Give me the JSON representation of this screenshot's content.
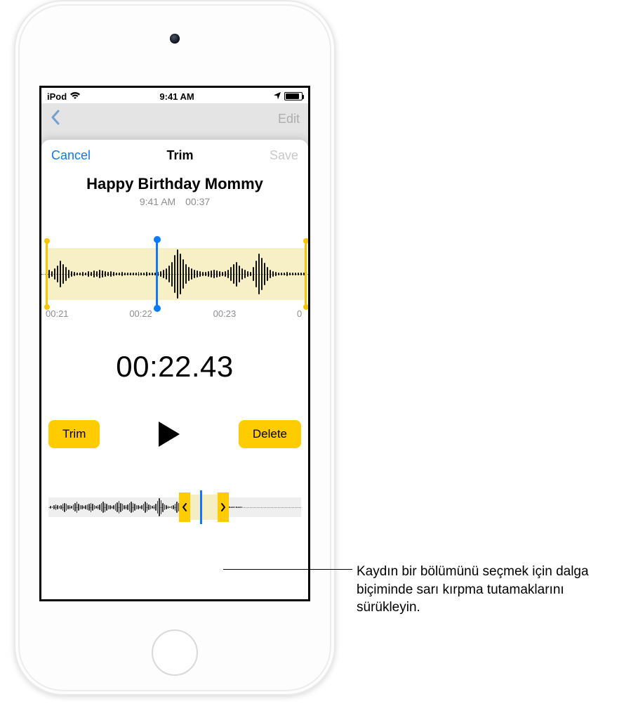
{
  "statusbar": {
    "device_label": "iPod",
    "time": "9:41 AM"
  },
  "bg_nav": {
    "edit_label": "Edit"
  },
  "sheet": {
    "cancel_label": "Cancel",
    "title": "Trim",
    "save_label": "Save",
    "recording_title": "Happy Birthday Mommy",
    "recording_time": "9:41 AM",
    "recording_duration": "00:37",
    "zoom_time_labels": [
      "00:21",
      "00:22",
      "00:23",
      "0"
    ],
    "playhead_time": "00:22.43",
    "trim_button_label": "Trim",
    "delete_button_label": "Delete"
  },
  "waveform_zoom": {
    "bars": [
      6,
      4,
      8,
      12,
      20,
      14,
      10,
      6,
      4,
      3,
      2,
      2,
      3,
      2,
      4,
      3,
      5,
      4,
      6,
      5,
      4,
      3,
      4,
      3,
      2,
      2,
      3,
      2,
      2,
      2,
      2,
      2,
      3,
      2,
      2,
      3,
      2,
      2,
      2,
      3,
      4,
      6,
      8,
      12,
      18,
      28,
      36,
      30,
      22,
      14,
      10,
      8,
      6,
      5,
      4,
      3,
      3,
      4,
      5,
      6,
      5,
      4,
      3,
      4,
      6,
      10,
      14,
      18,
      12,
      8,
      6,
      4,
      3,
      10,
      20,
      30,
      24,
      16,
      10,
      6,
      4,
      3,
      2,
      2,
      2,
      3,
      2,
      2,
      2,
      2,
      2,
      2
    ],
    "selection_start_pct": 2,
    "selection_end_pct": 99,
    "playhead_pct": 43
  },
  "waveform_overview": {
    "bars": [
      3,
      2,
      4,
      6,
      4,
      3,
      5,
      8,
      10,
      7,
      5,
      4,
      3,
      6,
      9,
      12,
      8,
      5,
      4,
      3,
      4,
      6,
      8,
      10,
      7,
      5,
      3,
      4,
      6,
      9,
      12,
      10,
      7,
      5,
      4,
      3,
      5,
      8,
      11,
      14,
      10,
      7,
      5,
      4,
      6,
      9,
      13,
      10,
      7,
      5,
      4,
      3,
      5,
      8,
      12,
      9,
      6,
      4,
      3,
      5,
      8,
      14,
      20,
      16,
      10,
      6,
      4,
      3,
      2,
      3,
      5,
      8,
      12,
      9,
      6,
      4,
      3,
      2,
      3,
      4,
      6,
      5,
      4,
      3,
      2,
      3,
      4,
      6,
      8,
      6,
      4,
      3,
      2,
      2,
      3,
      4,
      3,
      2,
      2,
      3,
      4,
      3,
      2,
      2,
      2,
      2,
      2,
      2,
      2,
      2
    ],
    "selection_left_pct": 56,
    "selection_width_pct": 11,
    "playhead_pct": 60
  },
  "callout": {
    "text": "Kaydın bir bölümünü seçmek için dalga biçiminde sarı kırpma tutamaklarını sürükleyin."
  }
}
